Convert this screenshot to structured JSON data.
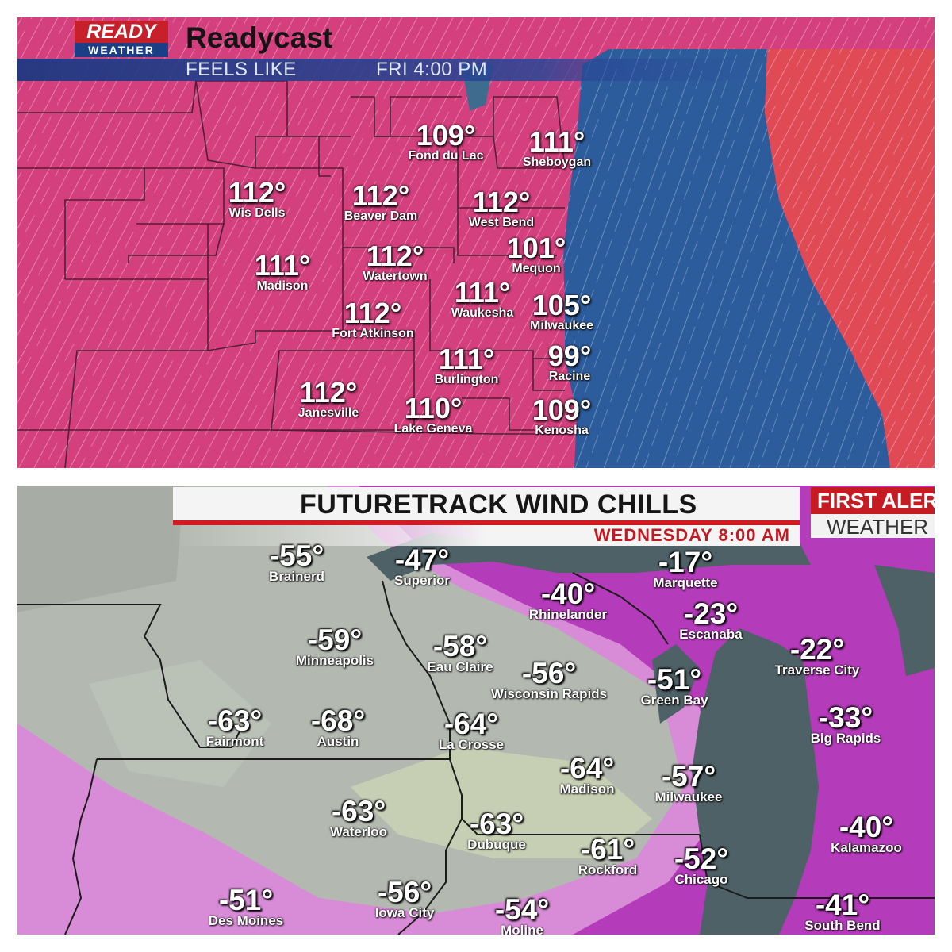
{
  "top_map": {
    "logo": {
      "line1": "READY",
      "line2": "WEATHER"
    },
    "title": "Readycast",
    "subtitle": "FEELS LIKE",
    "time": "FRI  4:00 PM",
    "colors": {
      "heat": "#d4407e",
      "lake": "#2d5c9c",
      "east_shore": "#e04a55"
    },
    "labels": [
      {
        "temp": "109°",
        "city": "Fond du Lac"
      },
      {
        "temp": "111°",
        "city": "Sheboygan"
      },
      {
        "temp": "112°",
        "city": "Wis Dells"
      },
      {
        "temp": "112°",
        "city": "Beaver Dam"
      },
      {
        "temp": "112°",
        "city": "West Bend"
      },
      {
        "temp": "101°",
        "city": "Mequon"
      },
      {
        "temp": "111°",
        "city": "Madison"
      },
      {
        "temp": "112°",
        "city": "Watertown"
      },
      {
        "temp": "111°",
        "city": "Waukesha"
      },
      {
        "temp": "105°",
        "city": "Milwaukee"
      },
      {
        "temp": "112°",
        "city": "Fort Atkinson"
      },
      {
        "temp": "111°",
        "city": "Burlington"
      },
      {
        "temp": "99°",
        "city": "Racine"
      },
      {
        "temp": "112°",
        "city": "Janesville"
      },
      {
        "temp": "110°",
        "city": "Lake Geneva"
      },
      {
        "temp": "109°",
        "city": "Kenosha"
      }
    ]
  },
  "bottom_map": {
    "title": "FUTURETRACK WIND CHILLS",
    "time": "WEDNESDAY 8:00 AM",
    "badge": {
      "line1": "FIRST ALER",
      "line2": "WEATHER"
    },
    "colors": {
      "cold_gray": "#b3b9b0",
      "magenta": "#b43bb9",
      "lake": "#4e6166",
      "accent": "#d11a22"
    },
    "labels": [
      {
        "temp": "-55°",
        "city": "Brainerd"
      },
      {
        "temp": "-47°",
        "city": "Superior"
      },
      {
        "temp": "-17°",
        "city": "Marquette"
      },
      {
        "temp": "-40°",
        "city": "Rhinelander"
      },
      {
        "temp": "-23°",
        "city": "Escanaba"
      },
      {
        "temp": "-59°",
        "city": "Minneapolis"
      },
      {
        "temp": "-58°",
        "city": "Eau Claire"
      },
      {
        "temp": "-56°",
        "city": "Wisconsin Rapids"
      },
      {
        "temp": "-51°",
        "city": "Green Bay"
      },
      {
        "temp": "-22°",
        "city": "Traverse City"
      },
      {
        "temp": "-33°",
        "city": "Big Rapids"
      },
      {
        "temp": "-63°",
        "city": "Fairmont"
      },
      {
        "temp": "-68°",
        "city": "Austin"
      },
      {
        "temp": "-64°",
        "city": "La Crosse"
      },
      {
        "temp": "-64°",
        "city": "Madison"
      },
      {
        "temp": "-57°",
        "city": "Milwaukee"
      },
      {
        "temp": "-63°",
        "city": "Waterloo"
      },
      {
        "temp": "-63°",
        "city": "Dubuque"
      },
      {
        "temp": "-61°",
        "city": "Rockford"
      },
      {
        "temp": "-52°",
        "city": "Chicago"
      },
      {
        "temp": "-40°",
        "city": "Kalamazoo"
      },
      {
        "temp": "-51°",
        "city": "Des Moines"
      },
      {
        "temp": "-56°",
        "city": "Iowa City"
      },
      {
        "temp": "-54°",
        "city": "Moline"
      },
      {
        "temp": "-41°",
        "city": "South Bend"
      }
    ]
  }
}
